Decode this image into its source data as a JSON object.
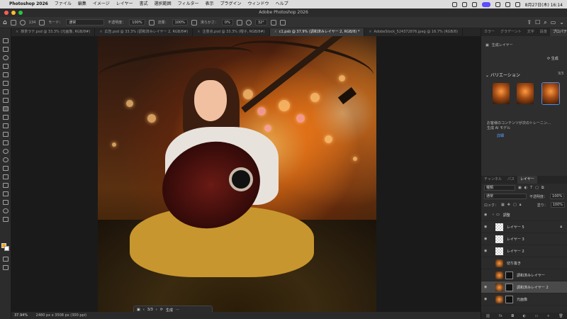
{
  "menubar": {
    "app": "Photoshop 2026",
    "items": [
      "ファイル",
      "編集",
      "イメージ",
      "レイヤー",
      "書式",
      "選択範囲",
      "フィルター",
      "表示",
      "プラグイン",
      "ウィンドウ",
      "ヘルプ"
    ],
    "clock": "8月27日(木) 16:14"
  },
  "window": {
    "title": "Adobe Photoshop 2026"
  },
  "options": {
    "mode_label": "モード：",
    "mode_value": "通常",
    "opacity_label": "不透明度：",
    "opacity_value": "100%",
    "flow_label": "流量：",
    "flow_value": "100%",
    "smooth_label": "滑らかさ：",
    "smooth_value": "0%",
    "angle_value": "32°",
    "brush_size": "134"
  },
  "tabs": [
    {
      "label": "抹茶ラテ.psd @ 33.3% (元画像, RGB/8#)",
      "active": false
    },
    {
      "label": "広告.psd @ 33.3% (調和済みレイヤー 2, RGB/8#)",
      "active": false
    },
    {
      "label": "注意点.psd @ 33.3% (帽子, RGB/8#)",
      "active": false
    },
    {
      "label": "c1.psb @ 37.9% (調和済みレイヤー 2, RGB/8) *",
      "active": true
    },
    {
      "label": "AdobeStock_524372876.jpeg @ 16.7% (RGB/8)",
      "active": false
    }
  ],
  "floatbar": {
    "counter": "3/3",
    "generate_label": "生成"
  },
  "status": {
    "zoom": "37.94%",
    "info": "2480 px x 3508 px (300 ppi)"
  },
  "properties": {
    "tabs": [
      "カラー",
      "グラデーント",
      "文字",
      "段落",
      "プロパティ"
    ],
    "layer_type": "生成レイヤー",
    "generate_label": "生成",
    "variations_title": "バリエーション",
    "variations_count": "3/3",
    "warning_line1": "お客様のコンテンツが次のトレーニン…",
    "warning_line2": "生成 AI モデル",
    "link_label": "詳細"
  },
  "layers": {
    "tabs": [
      "チャンネル",
      "パス",
      "レイヤー"
    ],
    "filter_label": "種類",
    "blend_mode": "通常",
    "opacity_label": "不透明度：",
    "opacity_value": "100%",
    "lock_label": "ロック：",
    "fill_label": "塗り：",
    "fill_value": "100%",
    "items": [
      {
        "name": "調整",
        "kind": "group",
        "visible": true
      },
      {
        "name": "レイヤー 5",
        "kind": "pixel",
        "visible": true,
        "locked": true
      },
      {
        "name": "レイヤー 3",
        "kind": "pixel",
        "visible": true
      },
      {
        "name": "レイヤー 2",
        "kind": "pixel",
        "visible": true
      },
      {
        "name": "切り抜き",
        "kind": "photo",
        "visible": false
      },
      {
        "name": "調和済みレイヤー",
        "kind": "masked",
        "visible": false
      },
      {
        "name": "調和済みレイヤー 2",
        "kind": "masked",
        "visible": true,
        "selected": true
      },
      {
        "name": "元画像",
        "kind": "masked",
        "visible": true
      }
    ]
  },
  "colors": {
    "foreground": "#f0a820",
    "background": "#ffffff",
    "accent": "#4a8ef2"
  }
}
